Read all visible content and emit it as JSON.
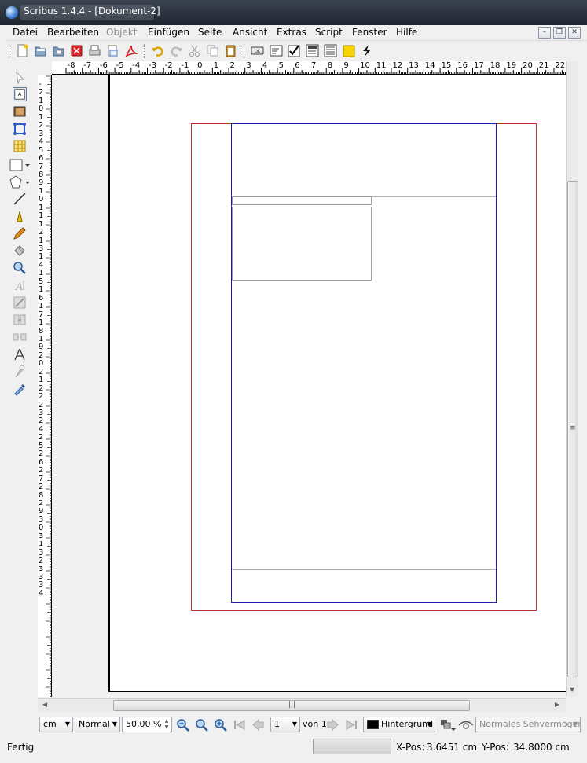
{
  "window": {
    "title": "Scribus 1.4.4 - [Dokument-2]"
  },
  "menubar": {
    "items": [
      {
        "label": "Datei"
      },
      {
        "label": "Bearbeiten"
      },
      {
        "label": "Objekt"
      },
      {
        "label": "Einfügen"
      },
      {
        "label": "Seite"
      },
      {
        "label": "Ansicht"
      },
      {
        "label": "Extras"
      },
      {
        "label": "Script"
      },
      {
        "label": "Fenster"
      },
      {
        "label": "Hilfe"
      }
    ]
  },
  "toolbar": {
    "icons": [
      "new-document-icon",
      "open-icon",
      "open-recent-icon",
      "close-icon",
      "print-icon",
      "preflight-icon",
      "export-pdf-icon",
      "undo-icon",
      "redo-icon",
      "cut-icon",
      "copy-icon",
      "paste-icon",
      "pdf-button-icon",
      "pdf-textfield-icon",
      "pdf-checkbox-icon",
      "pdf-combobox-icon",
      "pdf-listbox-icon",
      "text-annotation-icon",
      "link-annotation-icon"
    ]
  },
  "rulers": {
    "horizontal_labels": [
      "-8",
      "-7",
      "-6",
      "-5",
      "-4",
      "-3",
      "-2",
      "-1",
      "0",
      "1",
      "2",
      "3",
      "4",
      "5",
      "6",
      "7",
      "8",
      "9",
      "10",
      "11",
      "12",
      "13",
      "14",
      "15",
      "16",
      "17",
      "18",
      "19",
      "20",
      "21",
      "22"
    ],
    "vertical_labels": [
      "-",
      "2",
      "1",
      "0",
      "1",
      "2",
      "3",
      "4",
      "5",
      "6",
      "7",
      "8",
      "9",
      "1",
      "0",
      "1",
      "1",
      "1",
      "2",
      "1",
      "3",
      "1",
      "4",
      "1",
      "5",
      "1",
      "6",
      "1",
      "7",
      "1",
      "8",
      "1",
      "9",
      "2",
      "0",
      "2",
      "1",
      "2",
      "2",
      "2",
      "3",
      "2",
      "4",
      "2",
      "5",
      "2",
      "6",
      "2",
      "7",
      "2",
      "8",
      "2",
      "9",
      "3",
      "0",
      "3",
      "1",
      "3",
      "2",
      "3",
      "3",
      "3",
      "4"
    ]
  },
  "bottombar": {
    "unit": "cm",
    "mode": "Normal",
    "zoom": "50,00 %",
    "page": "1",
    "page_of": "von 1",
    "layer": "Hintergrund",
    "view_mode": "Normales Sehvermögen"
  },
  "statusbar": {
    "status": "Fertig",
    "xpos_label": "X-Pos:",
    "xpos_value": "3.6451 cm",
    "ypos_label": "Y-Pos:",
    "ypos_value": "34.8000 cm"
  },
  "colors": {
    "bleed": "#c0302c",
    "margin": "#1a1ab0",
    "layer_swatch": "#000000"
  }
}
